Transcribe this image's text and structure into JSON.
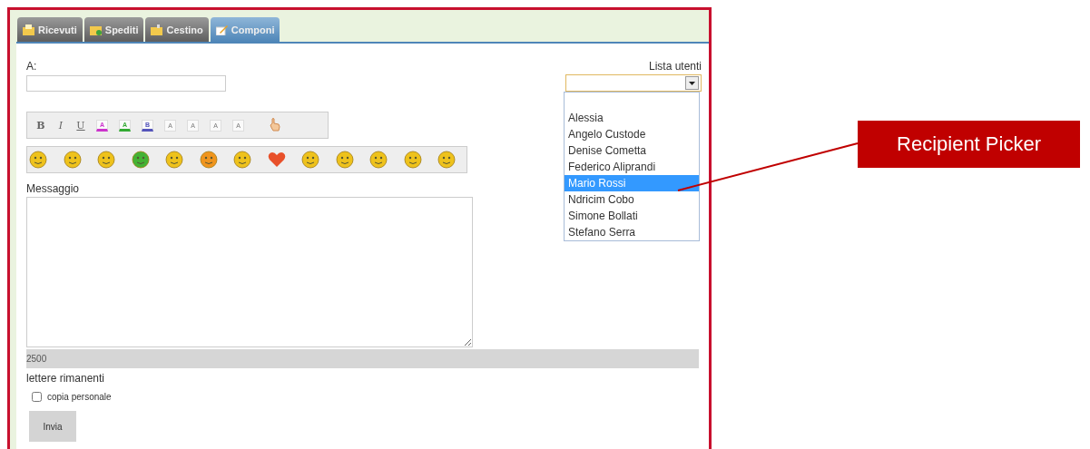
{
  "tabs": [
    {
      "label": "Ricevuti",
      "kind": "inbox",
      "selected": false
    },
    {
      "label": "Spediti",
      "kind": "sent",
      "selected": false
    },
    {
      "label": "Cestino",
      "kind": "trash",
      "selected": false
    },
    {
      "label": "Componi",
      "kind": "compose",
      "selected": true
    }
  ],
  "to": {
    "label": "A:"
  },
  "format_buttons": [
    {
      "kind": "bold",
      "label": "B"
    },
    {
      "kind": "italic",
      "label": "I"
    },
    {
      "kind": "underline",
      "label": "U"
    },
    {
      "kind": "swatch",
      "label": "A",
      "color": "#cc33cc"
    },
    {
      "kind": "swatch",
      "label": "A",
      "color": "#33aa33"
    },
    {
      "kind": "swatch",
      "label": "B",
      "color": "#5555bb"
    },
    {
      "kind": "size",
      "label": "A"
    },
    {
      "kind": "size",
      "label": "A"
    },
    {
      "kind": "size",
      "label": "A"
    },
    {
      "kind": "size",
      "label": "A"
    },
    {
      "kind": "hand"
    }
  ],
  "emoticons": [
    {
      "kind": "face",
      "color": "#eec21c"
    },
    {
      "kind": "face",
      "color": "#eec21c"
    },
    {
      "kind": "face",
      "color": "#eec21c"
    },
    {
      "kind": "face",
      "color": "#44b233"
    },
    {
      "kind": "face",
      "color": "#eec21c"
    },
    {
      "kind": "face",
      "color": "#f0941c"
    },
    {
      "kind": "face",
      "color": "#eec21c"
    },
    {
      "kind": "heart",
      "color": "#e8502a"
    },
    {
      "kind": "face",
      "color": "#eec21c"
    },
    {
      "kind": "face",
      "color": "#eec21c"
    },
    {
      "kind": "face",
      "color": "#eec21c"
    },
    {
      "kind": "face",
      "color": "#eec21c"
    },
    {
      "kind": "face",
      "color": "#eec21c"
    }
  ],
  "message": {
    "label": "Messaggio"
  },
  "user_list": {
    "label": "Lista utenti",
    "items": [
      {
        "label": "Alessia",
        "selected": false
      },
      {
        "label": "Angelo Custode",
        "selected": false
      },
      {
        "label": "Denise Cometta",
        "selected": false
      },
      {
        "label": "Federico Aliprandi",
        "selected": false
      },
      {
        "label": "Mario Rossi",
        "selected": true
      },
      {
        "label": "Ndricim Cobo",
        "selected": false
      },
      {
        "label": "Simone Bollati",
        "selected": false
      },
      {
        "label": "Stefano Serra",
        "selected": false
      }
    ]
  },
  "counter": {
    "value": "2500",
    "label": "lettere rimanenti"
  },
  "personal_copy": {
    "label": "copia personale",
    "checked": false
  },
  "send_button": "Invia",
  "callout": "Recipient Picker"
}
